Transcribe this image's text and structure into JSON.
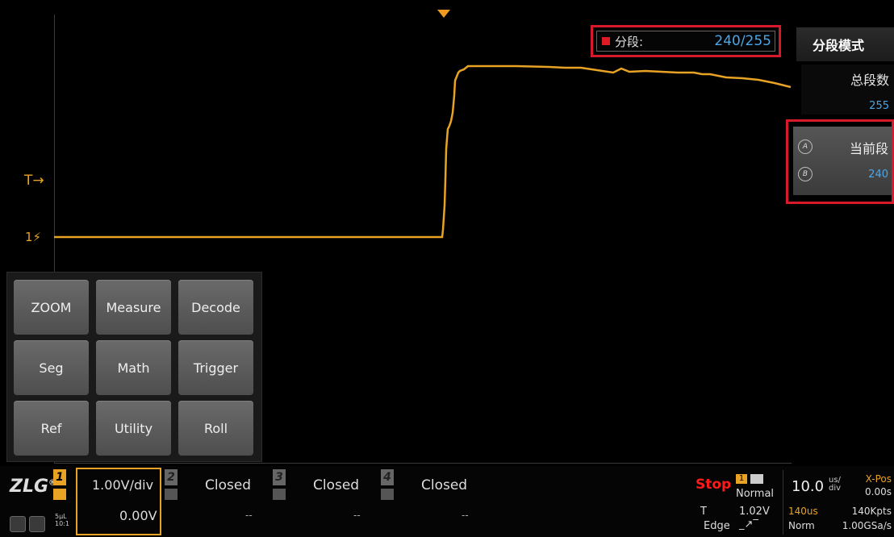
{
  "segment_indicator": {
    "label": "分段:",
    "value": "240/255"
  },
  "side_menu": {
    "title": "分段模式",
    "total_segments": {
      "label": "总段数",
      "value": "255"
    },
    "current_segment": {
      "label": "当前段",
      "value": "240",
      "knob_a": "A",
      "knob_b": "B"
    }
  },
  "markers": {
    "trigger": "T→",
    "channel1": "1⚡"
  },
  "quick_menu": [
    "ZOOM",
    "Measure",
    "Decode",
    "Seg",
    "Math",
    "Trigger",
    "Ref",
    "Utility",
    "Roll"
  ],
  "channels": {
    "ch1": {
      "num": "1",
      "vdiv": "1.00V/div",
      "offset": "0.00V",
      "probe": "5μL\n10:1"
    },
    "ch2": {
      "num": "2",
      "status": "Closed",
      "dash": "--"
    },
    "ch3": {
      "num": "3",
      "status": "Closed",
      "dash": "--"
    },
    "ch4": {
      "num": "4",
      "status": "Closed",
      "dash": "--"
    }
  },
  "acquisition": {
    "run_state": "Stop",
    "trig_channel": "1",
    "mode": "Normal",
    "trig_label": "T",
    "trig_level": "1.02V",
    "trig_type": "Edge"
  },
  "timebase": {
    "scale": "10.0",
    "unit": "us/\ndiv",
    "xpos_label": "X-Pos",
    "xpos": "0.00s",
    "length": "140us",
    "points": "140Kpts",
    "mode": "Norm",
    "rate": "1.00GSa/s"
  },
  "logo": "ZLG",
  "colors": {
    "trace": "#e8a224",
    "highlight_box": "#d8192b",
    "value_blue": "#4ba6e8"
  }
}
